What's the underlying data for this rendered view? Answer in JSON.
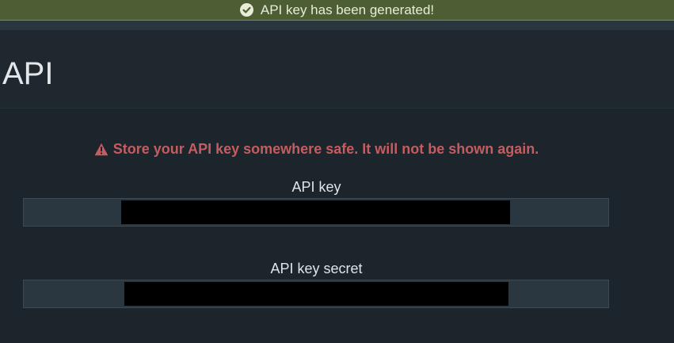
{
  "notification": {
    "message": "API key has been generated!",
    "icon": "check-circle-icon",
    "color": "#4d5d34"
  },
  "page": {
    "title": "API"
  },
  "warning": {
    "icon": "warning-triangle-icon",
    "text": "Store your API key somewhere safe. It will not be shown again.",
    "color": "#c45c60"
  },
  "fields": [
    {
      "label": "API key",
      "value_redacted": true
    },
    {
      "label": "API key secret",
      "value_redacted": true
    }
  ]
}
